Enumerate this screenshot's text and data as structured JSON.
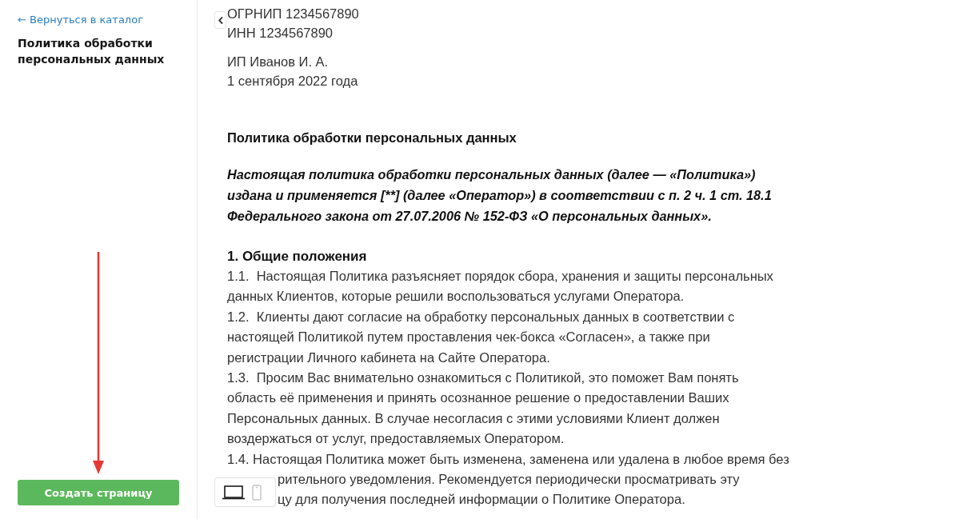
{
  "sidebar": {
    "back_link": "← Вернуться в каталог",
    "title": "Политика обработки персональных данных",
    "create_button": "Создать страницу"
  },
  "document": {
    "requisites": [
      "ОГРНИП 1234567890",
      "ИНН 1234567890"
    ],
    "signature": [
      "ИП Иванов И. А.",
      "1 сентября 2022 года"
    ],
    "title": "Политика обработки персональных данных",
    "preamble": "Настоящая политика обработки персональных данных (далее — «Политика») издана и применяется [**] (далее «Оператор») в соответствии с п. 2 ч. 1 ст. 18.1 Федерального закона от 27.07.2006 № 152-ФЗ «О персональных данных».",
    "sections": [
      {
        "heading": "1. Общие положения",
        "items": [
          {
            "kind": "paragraph",
            "text": "1.1.  Настоящая Политика разъясняет порядок сбора, хранения и защиты персональных данных Клиентов, которые решили воспользоваться услугами Оператора."
          },
          {
            "kind": "paragraph",
            "text": "1.2.  Клиенты дают согласие на обработку персональных данных в соответствии с настоящей Политикой путем проставления чек-бокса «Согласен», а также при регистрации Личного кабинета на Сайте Оператора."
          },
          {
            "kind": "paragraph",
            "text": "1.3.  Просим Вас внимательно ознакомиться с Политикой, это поможет Вам понять область её применения и принять осознанное решение о предоставлении Ваших Персональных данных. В случае несогласия с этими условиями Клиент должен воздержаться от услуг, предоставляемых Оператором."
          },
          {
            "kind": "covered",
            "lines": [
              "1.4. Настоящая Политика может быть изменена, заменена или удалена в любое время без",
              "рительного уведомления. Рекомендуется периодически просматривать эту",
              "цу для получения последней информации о Политике Оператора."
            ]
          }
        ]
      }
    ]
  },
  "device_toggle": [
    {
      "kind": "desktop",
      "selected": true
    },
    {
      "kind": "mobile",
      "selected": false
    }
  ]
}
